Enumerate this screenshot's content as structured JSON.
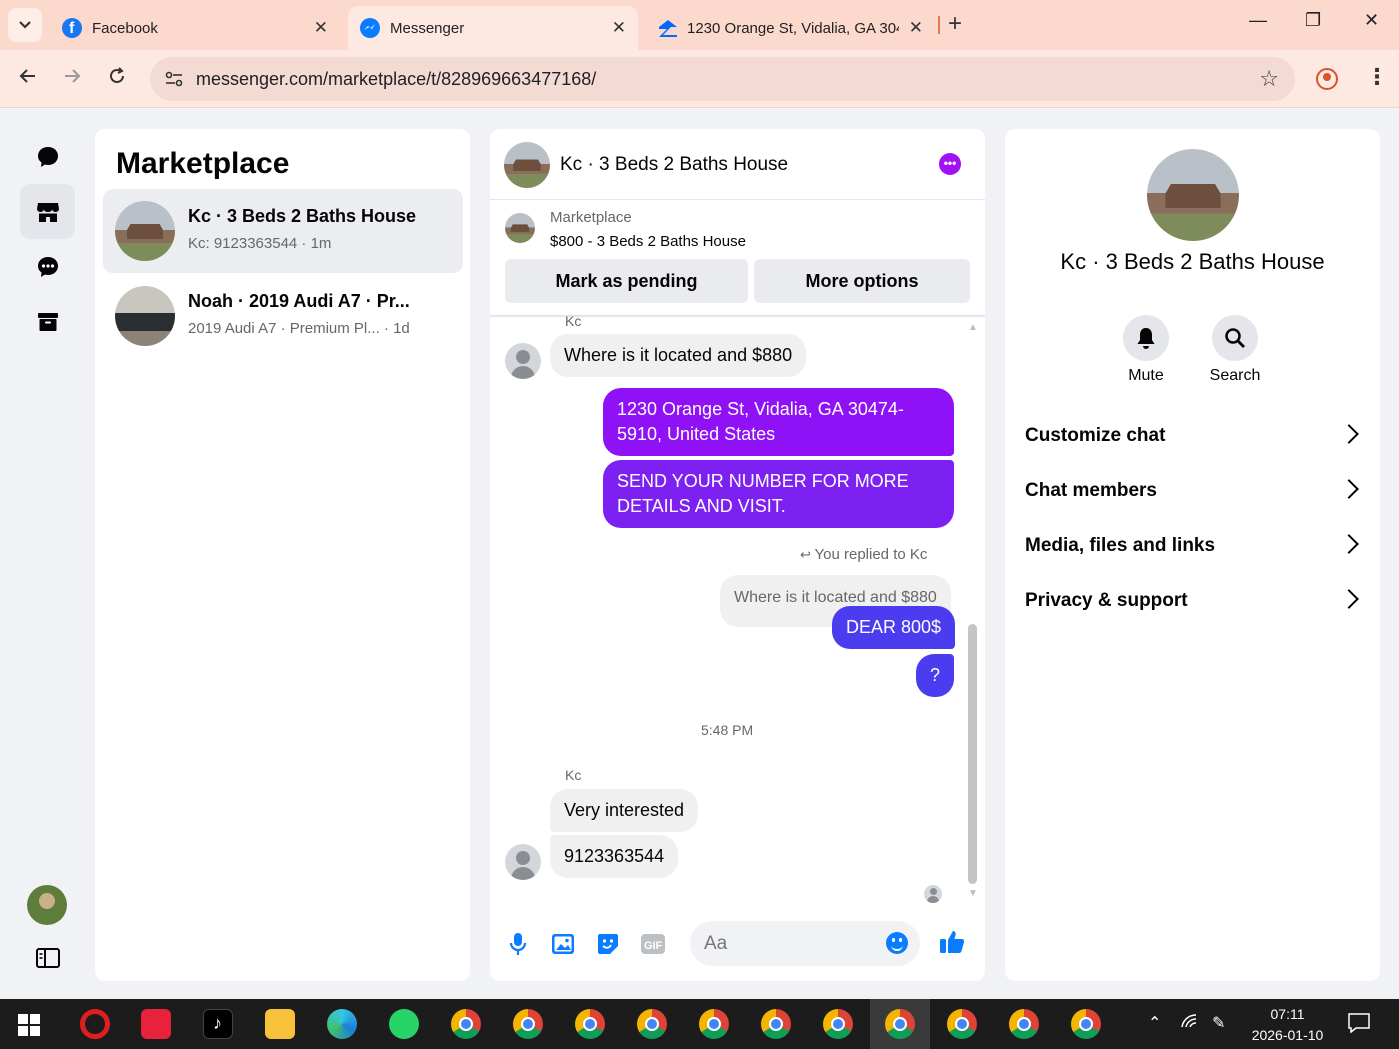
{
  "browser": {
    "tabs": [
      {
        "title": "Facebook",
        "favicon_color": "#1877f2"
      },
      {
        "title": "Messenger",
        "favicon_color": "#0a7cff",
        "active": true
      },
      {
        "title": "1230 Orange St, Vidalia, GA 304",
        "favicon_color": "#006aff"
      }
    ],
    "new_tab": "+",
    "url": "messenger.com/marketplace/t/828969663477168/",
    "window_controls": [
      "—",
      "❐",
      "✕"
    ]
  },
  "rail": {
    "items": [
      "chats-icon",
      "marketplace-icon",
      "message-requests-icon",
      "archive-icon"
    ],
    "active": "marketplace-icon"
  },
  "marketplace": {
    "title": "Marketplace",
    "conversations": [
      {
        "name": "Kc · 3 Beds 2 Baths House",
        "preview": "Kc: 9123363544 · 1m",
        "active": true
      },
      {
        "name": "Noah · 2019 Audi A7 · Pr...",
        "preview": "2019 Audi A7 · Premium Pl... · 1d",
        "active": false
      }
    ]
  },
  "chat": {
    "title": "Kc · 3 Beds 2 Baths House",
    "listing_label": "Marketplace",
    "listing_price": "$800 - 3 Beds 2 Baths House",
    "mark_pending": "Mark as pending",
    "more_options": "More options",
    "messages": {
      "sender1": "Kc",
      "incoming1": "Where is it located and $880",
      "outgoing1": "1230 Orange St, Vidalia, GA 30474-5910, United States",
      "outgoing2": "SEND YOUR NUMBER FOR MORE DETAILS AND VISIT.",
      "reply_note": "You replied to Kc",
      "quoted": "Where is it located and $880",
      "outgoing3": "DEAR 800$",
      "outgoing4": "?",
      "timestamp": "5:48 PM",
      "sender2": "Kc",
      "incoming2": "Very interested",
      "incoming3": "9123363544"
    },
    "composer_placeholder": "Aa",
    "colors": {
      "outgoing_purple": "#8f11f5",
      "outgoing_indigo": "#4b3cf0",
      "accent_blue": "#0a7cff"
    }
  },
  "info": {
    "name": "Kc · 3 Beds 2 Baths House",
    "mute": "Mute",
    "search": "Search",
    "menu": [
      "Customize chat",
      "Chat members",
      "Media, files and links",
      "Privacy & support"
    ]
  },
  "taskbar": {
    "time": "07:11",
    "date": "2026-01-10"
  }
}
